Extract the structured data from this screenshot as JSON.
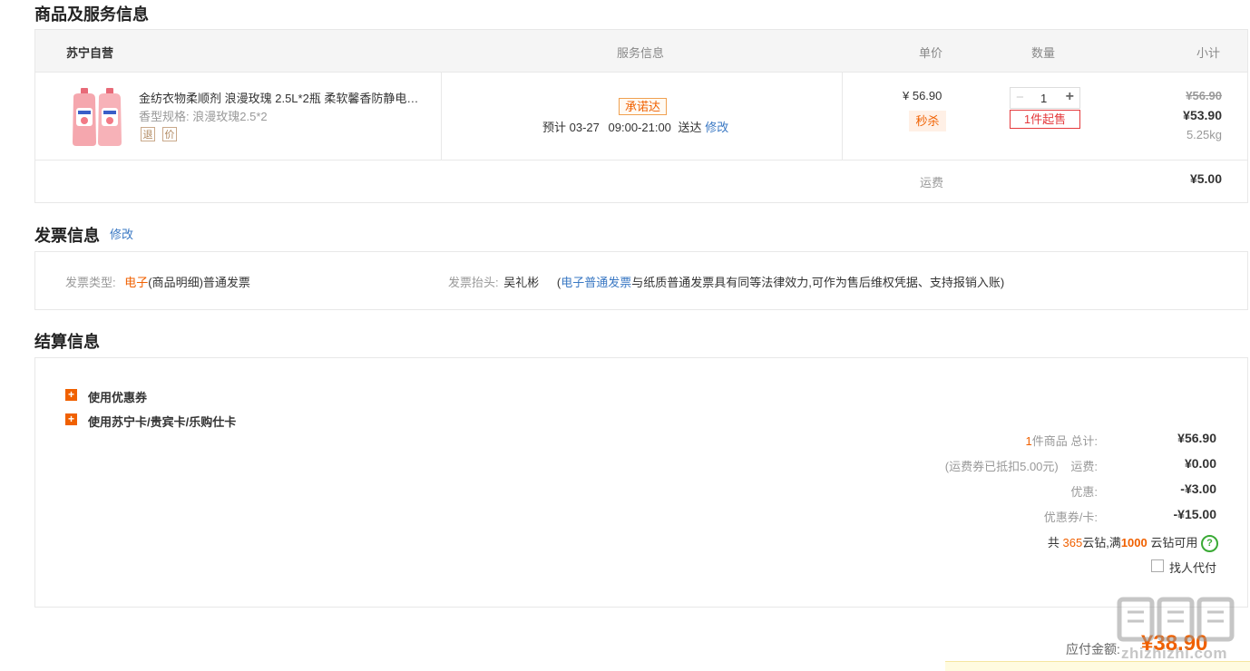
{
  "sections": {
    "goods_title": "商品及服务信息",
    "invoice_title": "发票信息",
    "invoice_edit": "修改",
    "settle_title": "结算信息"
  },
  "goods": {
    "headers": {
      "store": "苏宁自营",
      "service": "服务信息",
      "unit_price": "单价",
      "quantity": "数量",
      "subtotal": "小计"
    },
    "item": {
      "name": "金纺衣物柔顺剂 浪漫玫瑰 2.5L*2瓶 柔软馨香防静电…",
      "spec_label": "香型规格:",
      "spec_value": "浪漫玫瑰2.5*2",
      "tag1": "退",
      "tag2": "价",
      "promise_badge": "承诺达",
      "eta_prefix": "预计",
      "eta_date": "03-27",
      "eta_time": "09:00-21:00",
      "eta_suffix": "送达",
      "eta_edit": "修改",
      "unit_price": "¥ 56.90",
      "seckill": "秒杀",
      "qty_minus": "−",
      "qty": "1",
      "qty_plus": "+",
      "min_buy": "1件起售",
      "orig_subtotal": "¥56.90",
      "subtotal": "¥53.90",
      "weight": "5.25kg"
    },
    "shipping_label": "运费",
    "shipping_value": "¥5.00"
  },
  "invoice": {
    "type_label": "发票类型:",
    "type_highlight": "电子",
    "type_rest": "(商品明细)普通发票",
    "title_label": "发票抬头:",
    "title_value": "吴礼彬",
    "note_open": "(",
    "note_link": "电子普通发票",
    "note_rest": "与纸质普通发票具有同等法律效力,可作为售后维权凭据、支持报销入账)"
  },
  "settle": {
    "coupon_option": "使用优惠券",
    "card_option": "使用苏宁卡/贵宾卡/乐购仕卡",
    "items_count": "1",
    "items_label": "件商品 总计:",
    "items_total": "¥56.90",
    "freight_note": "(运费券已抵扣5.00元)",
    "freight_label": "运费:",
    "freight_value": "¥0.00",
    "discount_label": "优惠:",
    "discount_value": "-¥3.00",
    "coupon_label": "优惠券/卡:",
    "coupon_value": "-¥15.00",
    "cloud_prefix": "共",
    "cloud_count": "365",
    "cloud_mid": "云钻,满",
    "cloud_threshold": "1000",
    "cloud_suffix": "云钻可用",
    "help": "?",
    "proxy_pay": "找人代付"
  },
  "payment": {
    "label": "应付金额:",
    "amount": "¥38.90"
  },
  "watermark": {
    "logo_text": "值",
    "site": "zhizhizhi.com"
  },
  "colors": {
    "accent": "#f06000",
    "link": "#3a78c3",
    "danger": "#e4393c",
    "help": "#3aaa35"
  }
}
